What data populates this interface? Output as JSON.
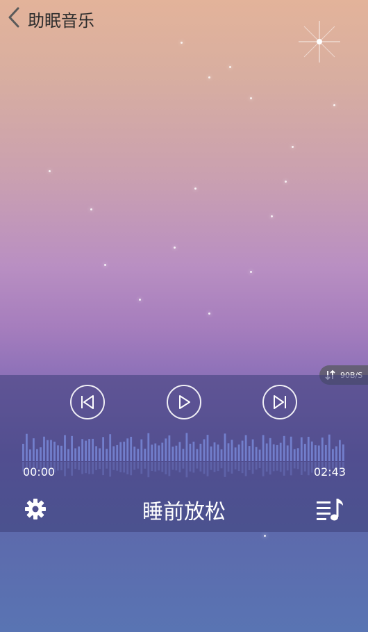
{
  "header": {
    "title": "助眠音乐"
  },
  "network": {
    "speed": "90B/S"
  },
  "player": {
    "current_time": "00:00",
    "total_time": "02:43",
    "song_title": "睡前放松",
    "progress": 0,
    "controls": [
      "previous",
      "play",
      "next"
    ]
  },
  "icons": {
    "back": "back-icon",
    "previous": "previous-icon",
    "play": "play-icon",
    "next": "next-icon",
    "settings": "gear-icon",
    "playlist": "playlist-icon",
    "network": "updown-arrows-icon"
  },
  "colors": {
    "bg_top": "#e3b39a",
    "bg_mid": "#b98fc2",
    "bg_bottom": "#5974b3",
    "panel": "#3c3e78",
    "wave": "#6f7ed0"
  }
}
